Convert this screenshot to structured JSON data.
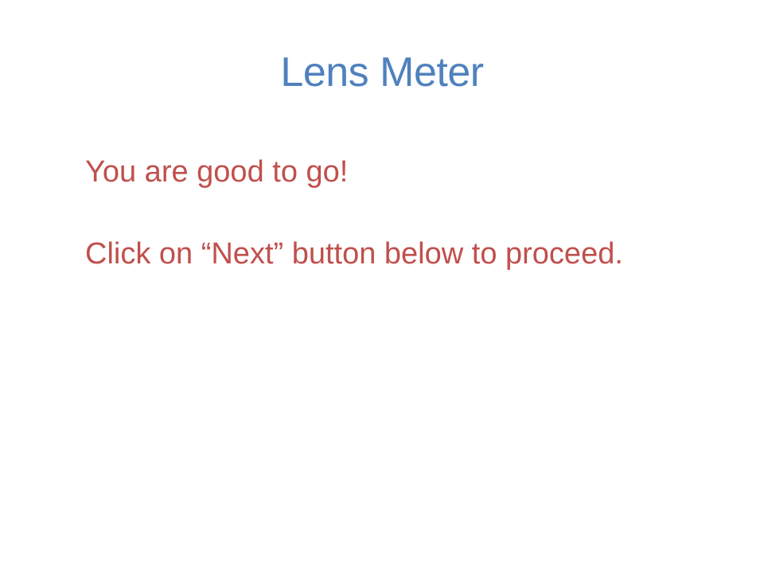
{
  "slide": {
    "title": "Lens Meter",
    "lines": [
      "You are good to go!",
      "Click on “Next” button below to proceed."
    ]
  },
  "colors": {
    "title": "#4f81bd",
    "body": "#c0504d",
    "background": "#ffffff"
  }
}
